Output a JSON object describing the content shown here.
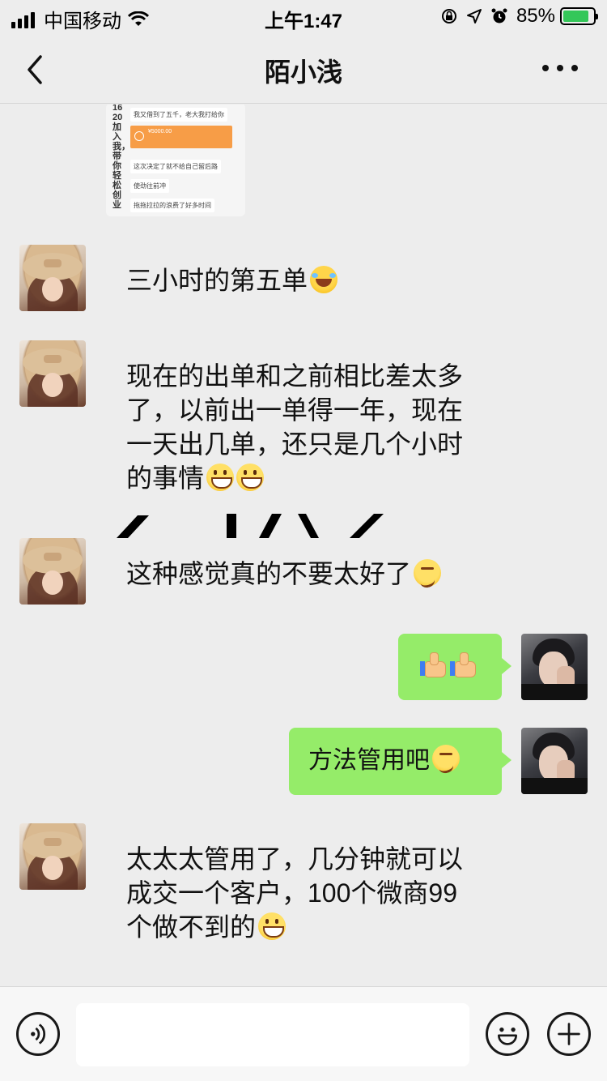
{
  "status_bar": {
    "carrier": "中国移动",
    "time": "上午1:47",
    "battery_percent": "85%",
    "battery_level": 0.85
  },
  "nav": {
    "title": "陌小浅"
  },
  "image_message": {
    "side_text": "1620加入我，带你轻松创业",
    "lines": [
      "我又借到了五千，老大我打给你",
      "这次决定了就不给自己留后路",
      "使劲往前冲",
      "拖拖拉拉的浪费了好多时间"
    ],
    "transfer_amount": "¥5000.00"
  },
  "messages": [
    {
      "side": "left",
      "text": "三小时的第五单",
      "emoji": "laugh-cry-icon"
    },
    {
      "side": "left",
      "lines": [
        "现在的出单和之前相比差太多",
        "了，以前出一单得一年，现在",
        "一天出几单，还只是几个小时",
        "的事情"
      ],
      "emoji": "grin-icon"
    },
    {
      "side": "left",
      "text": "这种感觉真的不要太好了",
      "emoji": "thinking-icon"
    },
    {
      "side": "right",
      "text": "",
      "emoji": "thumbs-up-icon"
    },
    {
      "side": "right",
      "text": "方法管用吧",
      "emoji": "thinking-icon"
    },
    {
      "side": "left",
      "lines": [
        "太太太管用了，几分钟就可以",
        "成交一个客户，100个微商99",
        "个做不到的"
      ],
      "emoji": "grin-icon"
    }
  ],
  "input": {
    "value": "",
    "placeholder": ""
  },
  "colors": {
    "background": "#ededed",
    "bubble_right": "#95ec69",
    "input_bar": "#f7f7f7"
  }
}
